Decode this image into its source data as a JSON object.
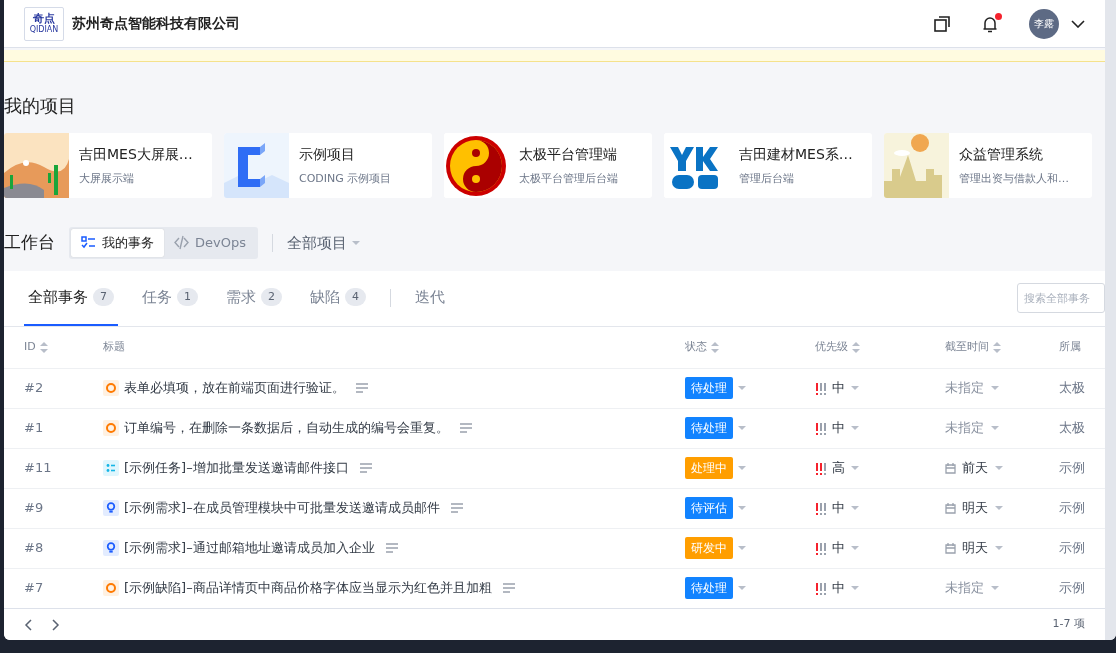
{
  "header": {
    "logo": {
      "name": "奇点",
      "latin": "QIDIAN"
    },
    "company": "苏州奇点智能科技有限公司",
    "notifications_unread": true,
    "user": "李露"
  },
  "projects_title": "我的项目",
  "projects": [
    {
      "name": "吉田MES大屏展…",
      "description": "大屏展示端"
    },
    {
      "name": "示例项目",
      "description": "CODING 示例项目"
    },
    {
      "name": "太极平台管理端",
      "description": "太极平台管理后台端"
    },
    {
      "name": "吉田建材MES系…",
      "description": "管理后台端"
    },
    {
      "name": "众益管理系统",
      "description": "管理出资与借款人和…"
    }
  ],
  "workbench": {
    "title": "工作台",
    "views": [
      {
        "label": "我的事务",
        "selected": true
      },
      {
        "label": "DevOps",
        "selected": false
      }
    ],
    "project_filter": "全部项目"
  },
  "tabs": [
    {
      "label": "全部事务",
      "count": "7",
      "kind": "filter",
      "selected": true
    },
    {
      "label": "任务",
      "count": "1",
      "kind": "filter",
      "selected": false
    },
    {
      "label": "需求",
      "count": "2",
      "kind": "filter",
      "selected": false
    },
    {
      "label": "缺陷",
      "count": "4",
      "kind": "filter",
      "selected": false
    },
    {
      "label": "迭代",
      "kind": "link",
      "selected": false
    }
  ],
  "search": {
    "placeholder": "搜索全部事务"
  },
  "table": {
    "columns": [
      {
        "label": "ID",
        "sortable": true
      },
      {
        "label": "标题",
        "sortable": false
      },
      {
        "label": "状态",
        "sortable": true
      },
      {
        "label": "优先级",
        "sortable": true
      },
      {
        "label": "截至时间",
        "sortable": true
      },
      {
        "label": "所属",
        "sortable": false
      }
    ],
    "rows": [
      {
        "id": "#2",
        "kind": "defect",
        "title": "表单必填项，放在前端页面进行验证。",
        "has_description": true,
        "status": {
          "label": "待处理",
          "color": "#1283ff"
        },
        "priority": {
          "label": "中",
          "kind": "medium"
        },
        "due": {
          "label": "未指定",
          "kind": "unset"
        },
        "project": "太极"
      },
      {
        "id": "#1",
        "kind": "defect",
        "title": "订单编号，在删除一条数据后，自动生成的编号会重复。",
        "has_description": true,
        "status": {
          "label": "待处理",
          "color": "#1283ff"
        },
        "priority": {
          "label": "中",
          "kind": "medium"
        },
        "due": {
          "label": "未指定",
          "kind": "unset"
        },
        "project": "太极"
      },
      {
        "id": "#11",
        "kind": "task",
        "title": "[示例任务]–增加批量发送邀请邮件接口",
        "has_description": true,
        "status": {
          "label": "处理中",
          "color": "#ff9e00"
        },
        "priority": {
          "label": "高",
          "kind": "high"
        },
        "due": {
          "label": "前天",
          "kind": "date"
        },
        "project": "示例"
      },
      {
        "id": "#9",
        "kind": "requirement",
        "title": "[示例需求]–在成员管理模块中可批量发送邀请成员邮件",
        "has_description": true,
        "status": {
          "label": "待评估",
          "color": "#1283ff"
        },
        "priority": {
          "label": "中",
          "kind": "medium"
        },
        "due": {
          "label": "明天",
          "kind": "date"
        },
        "project": "示例"
      },
      {
        "id": "#8",
        "kind": "requirement",
        "title": "[示例需求]–通过邮箱地址邀请成员加入企业",
        "has_description": true,
        "status": {
          "label": "研发中",
          "color": "#ff9e00"
        },
        "priority": {
          "label": "中",
          "kind": "medium"
        },
        "due": {
          "label": "明天",
          "kind": "date"
        },
        "project": "示例"
      },
      {
        "id": "#7",
        "kind": "defect",
        "title": "[示例缺陷]–商品详情页中商品价格字体应当显示为红色并且加粗",
        "has_description": true,
        "status": {
          "label": "待处理",
          "color": "#1283ff"
        },
        "priority": {
          "label": "中",
          "kind": "medium"
        },
        "due": {
          "label": "未指定",
          "kind": "unset"
        },
        "project": "示例"
      }
    ]
  },
  "pagination": {
    "range": "1-7 项"
  }
}
